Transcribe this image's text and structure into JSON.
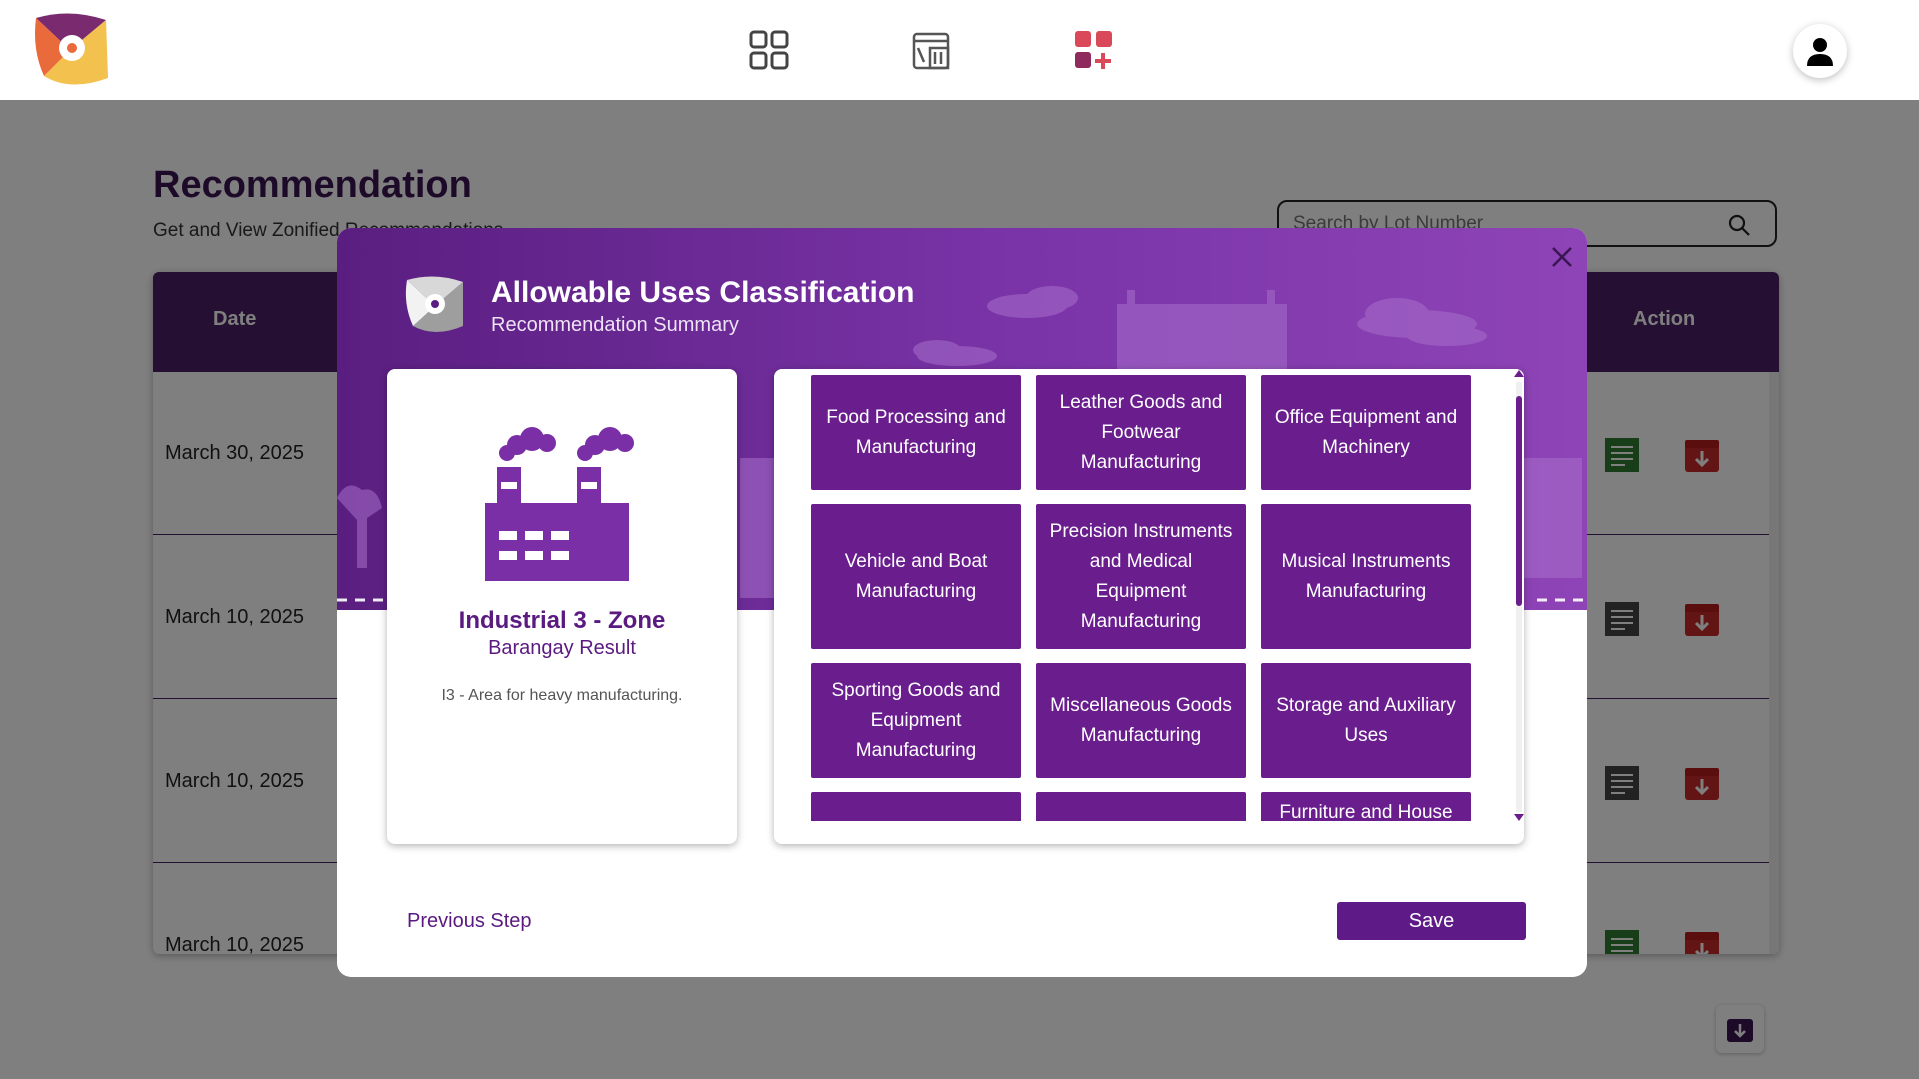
{
  "nav": {
    "icons": [
      "dashboard-grid-icon",
      "map-layers-icon",
      "add-apps-icon",
      "user-profile-icon"
    ]
  },
  "page": {
    "title": "Recommendation",
    "subtitle": "Get and View Zonified Recommendations",
    "search": {
      "placeholder": "Search by Lot Number"
    }
  },
  "table": {
    "headers": {
      "date": "Date",
      "action": "Action"
    },
    "rows": [
      {
        "date": "March 30, 2025"
      },
      {
        "date": "March 10, 2025"
      },
      {
        "date": "March 10, 2025"
      },
      {
        "date": "March 10, 2025"
      }
    ]
  },
  "modal": {
    "title": "Allowable Uses Classification",
    "subtitle": "Recommendation Summary",
    "zone": {
      "name": "Industrial 3 - Zone",
      "result": "Barangay Result",
      "description": "I3 - Area for heavy manufacturing."
    },
    "uses": [
      "Food Processing and Manufacturing",
      "Leather Goods and Footwear Manufacturing",
      "Office Equipment and Machinery",
      "Vehicle and Boat Manufacturing",
      "Precision Instruments and Medical Equipment Manufacturing",
      "Musical Instruments Manufacturing",
      "Sporting Goods and Equipment Manufacturing",
      "Miscellaneous Goods Manufacturing",
      "Storage and Auxiliary Uses",
      "",
      "",
      "Furniture and House"
    ],
    "previous_label": "Previous Step",
    "save_label": "Save"
  },
  "colors": {
    "primary": "#5e1a86",
    "header": "#4a2068",
    "doc_green": "#2e7d32",
    "doc_dark": "#444444",
    "download_red": "#c62828"
  }
}
